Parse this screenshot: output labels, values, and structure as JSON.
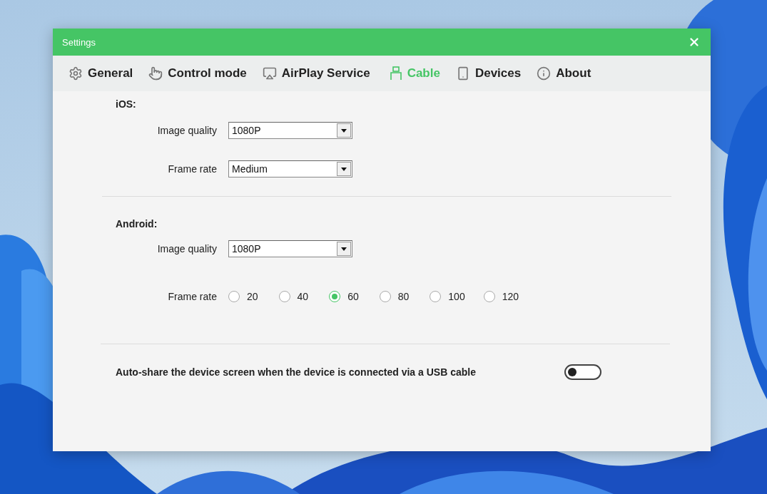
{
  "window": {
    "title": "Settings"
  },
  "tabs": [
    {
      "label": "General",
      "selected": false
    },
    {
      "label": "Control mode",
      "selected": false
    },
    {
      "label": "AirPlay Service",
      "selected": false
    },
    {
      "label": "Cable",
      "selected": true
    },
    {
      "label": "Devices",
      "selected": false
    },
    {
      "label": "About",
      "selected": false
    }
  ],
  "ios": {
    "heading": "iOS:",
    "fields": [
      {
        "label": "Image quality",
        "value": "1080P"
      },
      {
        "label": "Frame rate",
        "value": "Medium"
      }
    ]
  },
  "android": {
    "heading": "Android:",
    "image_quality": {
      "label": "Image quality",
      "value": "1080P"
    },
    "frame_rate": {
      "label": "Frame rate",
      "options": [
        {
          "label": "20",
          "selected": false
        },
        {
          "label": "40",
          "selected": false
        },
        {
          "label": "60",
          "selected": true
        },
        {
          "label": "80",
          "selected": false
        },
        {
          "label": "100",
          "selected": false
        },
        {
          "label": "120",
          "selected": false
        }
      ]
    }
  },
  "auto_share": {
    "text": "Auto-share the device screen when the device is connected via a USB cable",
    "on": false
  }
}
